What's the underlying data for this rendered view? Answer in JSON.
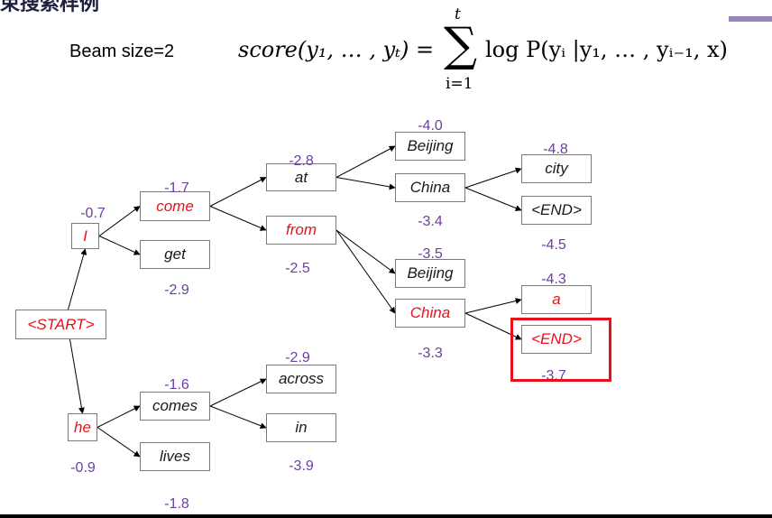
{
  "header": {
    "title_fragment": "束搜索样例"
  },
  "beam_size_label": "Beam size=2",
  "formula": {
    "lhs": "score(y₁, … , yₜ) =",
    "sum_upper": "t",
    "sum_lower": "i=1",
    "rhs": "log P(yᵢ |y₁, … , yᵢ₋₁, x)"
  },
  "colors": {
    "selected_text": "#e8101a",
    "default_text": "#1a1a1a",
    "score_text": "#6b3fa0",
    "highlight": "#e8101a",
    "accent_bar": "#9a85b8",
    "edge": "#000000"
  },
  "nodes": [
    {
      "id": "start",
      "label": "<START>",
      "selected": true
    },
    {
      "id": "I",
      "label": "I",
      "selected": true
    },
    {
      "id": "he",
      "label": "he",
      "selected": true
    },
    {
      "id": "come",
      "label": "come",
      "selected": true
    },
    {
      "id": "get",
      "label": "get",
      "selected": false
    },
    {
      "id": "comes",
      "label": "comes",
      "selected": false
    },
    {
      "id": "lives",
      "label": "lives",
      "selected": false
    },
    {
      "id": "at",
      "label": "at",
      "selected": false
    },
    {
      "id": "from",
      "label": "from",
      "selected": true
    },
    {
      "id": "across",
      "label": "across",
      "selected": false
    },
    {
      "id": "in",
      "label": "in",
      "selected": false
    },
    {
      "id": "beijing1",
      "label": "Beijing",
      "selected": false
    },
    {
      "id": "china1",
      "label": "China",
      "selected": false
    },
    {
      "id": "beijing2",
      "label": "Beijing",
      "selected": false
    },
    {
      "id": "china2",
      "label": "China",
      "selected": true
    },
    {
      "id": "city",
      "label": "city",
      "selected": false
    },
    {
      "id": "end1",
      "label": "<END>",
      "selected": false
    },
    {
      "id": "a",
      "label": "a",
      "selected": true
    },
    {
      "id": "end2",
      "label": "<END>",
      "selected": true
    }
  ],
  "scores": [
    {
      "node": "I",
      "value": "-0.7"
    },
    {
      "node": "he",
      "value": "-0.9"
    },
    {
      "node": "come",
      "value": "-1.7"
    },
    {
      "node": "get",
      "value": "-2.9"
    },
    {
      "node": "comes",
      "value": "-1.6"
    },
    {
      "node": "lives",
      "value": "-1.8"
    },
    {
      "node": "at",
      "value": "-2.8"
    },
    {
      "node": "from",
      "value": "-2.5"
    },
    {
      "node": "across",
      "value": "-2.9"
    },
    {
      "node": "in",
      "value": "-3.9"
    },
    {
      "node": "beijing1",
      "value": "-4.0"
    },
    {
      "node": "china1",
      "value": "-3.4"
    },
    {
      "node": "beijing2",
      "value": "-3.5"
    },
    {
      "node": "china2",
      "value": "-3.3"
    },
    {
      "node": "city",
      "value": "-4.8"
    },
    {
      "node": "end1",
      "value": "-4.5"
    },
    {
      "node": "a",
      "value": "-4.3"
    },
    {
      "node": "end2",
      "value": "-3.7"
    }
  ],
  "edges": [
    [
      "start",
      "I"
    ],
    [
      "start",
      "he"
    ],
    [
      "I",
      "come"
    ],
    [
      "I",
      "get"
    ],
    [
      "he",
      "comes"
    ],
    [
      "he",
      "lives"
    ],
    [
      "come",
      "at"
    ],
    [
      "come",
      "from"
    ],
    [
      "comes",
      "across"
    ],
    [
      "comes",
      "in"
    ],
    [
      "at",
      "beijing1"
    ],
    [
      "at",
      "china1"
    ],
    [
      "from",
      "beijing2"
    ],
    [
      "from",
      "china2"
    ],
    [
      "china1",
      "city"
    ],
    [
      "china1",
      "end1"
    ],
    [
      "china2",
      "a"
    ],
    [
      "china2",
      "end2"
    ]
  ],
  "highlighted_node": "end2"
}
